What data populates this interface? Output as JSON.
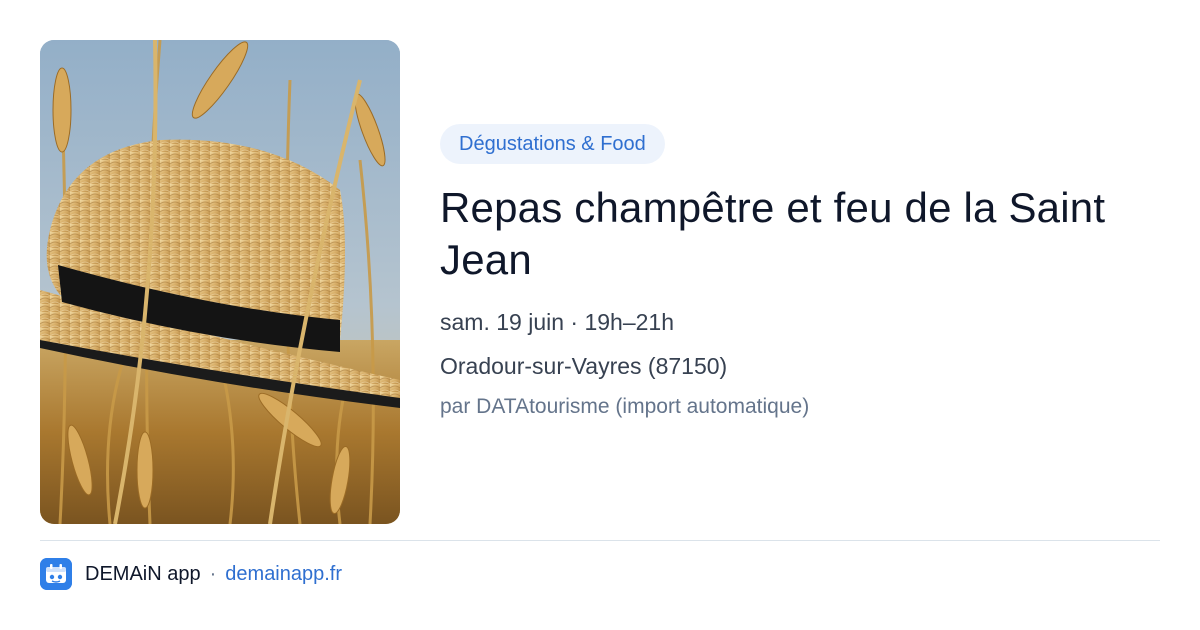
{
  "event": {
    "category": "Dégustations & Food",
    "title": "Repas champêtre et feu de la Saint Jean",
    "when": "sam. 19 juin · 19h–21h",
    "where": "Oradour-sur-Vayres (87150)",
    "source": "par DATAtourisme (import automatique)"
  },
  "footer": {
    "app_name": "DEMAiN app",
    "separator": "·",
    "link": "demainapp.fr"
  },
  "colors": {
    "accent": "#2f6fd0",
    "pill_bg": "#edf3fc",
    "logo_bg": "#2f7fe8"
  },
  "icons": {
    "event_photo": "straw-hat-in-wheat-field",
    "app_logo": "demain-app-logo"
  }
}
